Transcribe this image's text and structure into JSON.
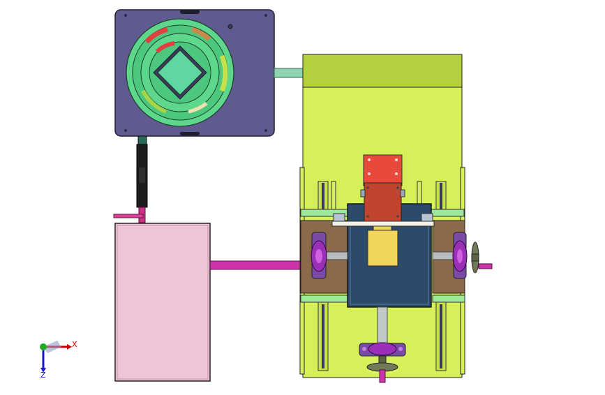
{
  "viewport": {
    "background": "#ffffff",
    "triad": {
      "x_label": "X",
      "z_label": "Z",
      "x_color": "#cc0000",
      "z_color": "#1a1acc",
      "origin_color": "#22aa22"
    }
  },
  "colors": {
    "panel_purple": "#5f5a8f",
    "lime": "#d6f05a",
    "lime_dark": "#b4d03c",
    "brown": "#8a6a4a",
    "navy": "#2c4a6a",
    "pink": "#f0c4d8",
    "magenta_shaft": "#cc33aa",
    "red_block": "#e84a3a",
    "red_block_dark": "#c0442e",
    "yellow_block": "#f2d65c",
    "teal_pipe": "#8fd4b0",
    "dial_green": "#5cd78c",
    "bearing_purple": "#9a2fb8",
    "rail_green": "#9ee89a"
  }
}
